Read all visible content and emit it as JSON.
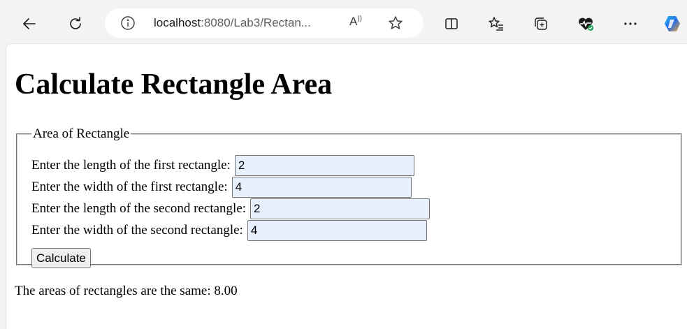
{
  "browser": {
    "url_host": "localhost",
    "url_rest": ":8080/Lab3/Rectan...",
    "read_aloud_label": "A"
  },
  "page": {
    "heading": "Calculate Rectangle Area",
    "fieldset_legend": "Area of Rectangle",
    "fields": [
      {
        "label": "Enter the length of the first rectangle:",
        "value": "2"
      },
      {
        "label": "Enter the width of the first rectangle:",
        "value": "4"
      },
      {
        "label": "Enter the length of the second rectangle:",
        "value": "2"
      },
      {
        "label": "Enter the width of the second rectangle:",
        "value": "4"
      }
    ],
    "calculate_label": "Calculate",
    "result_text": "The areas of rectangles are the same: 8.00"
  },
  "icons": {
    "back": "back-arrow-icon",
    "refresh": "refresh-icon",
    "info": "info-icon",
    "read_aloud": "read-aloud-icon",
    "favorite": "star-icon",
    "split_screen": "split-screen-icon",
    "favorites": "favorites-list-icon",
    "collections": "collections-icon",
    "health": "browser-essentials-icon",
    "more": "more-icon",
    "copilot": "copilot-icon"
  }
}
